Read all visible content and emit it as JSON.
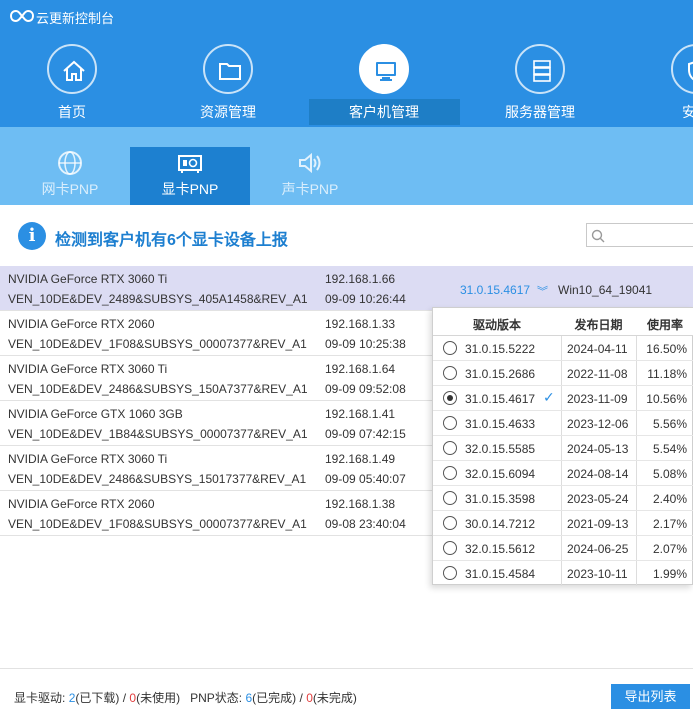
{
  "app": {
    "title": "云更新控制台",
    "logo_icon": "infinity-logo-icon"
  },
  "nav": {
    "items": [
      {
        "label": "首页",
        "icon": "home-icon"
      },
      {
        "label": "资源管理",
        "icon": "folder-icon"
      },
      {
        "label": "客户机管理",
        "icon": "monitor-icon",
        "active": true
      },
      {
        "label": "服务器管理",
        "icon": "server-icon"
      },
      {
        "label": "安全",
        "icon": "shield-icon"
      }
    ]
  },
  "subnav": {
    "items": [
      {
        "label": "网卡PNP",
        "icon": "globe-icon"
      },
      {
        "label": "显卡PNP",
        "icon": "graphics-card-icon",
        "active": true
      },
      {
        "label": "声卡PNP",
        "icon": "speaker-icon"
      }
    ]
  },
  "header": {
    "info_text": "检测到客户机有6个显卡设备上报",
    "info_icon": "info-icon",
    "search_icon": "search-icon"
  },
  "devices": [
    {
      "name": "NVIDIA GeForce RTX 3060 Ti",
      "id": "VEN_10DE&DEV_2489&SUBSYS_405A1458&REV_A1",
      "ip": "192.168.1.66",
      "time": "09-09 10:26:44",
      "version": "31.0.15.4617",
      "os": "Win10_64_19041"
    },
    {
      "name": "NVIDIA GeForce RTX 2060",
      "id": "VEN_10DE&DEV_1F08&SUBSYS_00007377&REV_A1",
      "ip": "192.168.1.33",
      "time": "09-09 10:25:38"
    },
    {
      "name": "NVIDIA GeForce RTX 3060 Ti",
      "id": "VEN_10DE&DEV_2486&SUBSYS_150A7377&REV_A1",
      "ip": "192.168.1.64",
      "time": "09-09 09:52:08"
    },
    {
      "name": "NVIDIA GeForce GTX 1060 3GB",
      "id": "VEN_10DE&DEV_1B84&SUBSYS_00007377&REV_A1",
      "ip": "192.168.1.41",
      "time": "09-09 07:42:15"
    },
    {
      "name": "NVIDIA GeForce RTX 3060 Ti",
      "id": "VEN_10DE&DEV_2486&SUBSYS_15017377&REV_A1",
      "ip": "192.168.1.49",
      "time": "09-09 05:40:07"
    },
    {
      "name": "NVIDIA GeForce RTX 2060",
      "id": "VEN_10DE&DEV_1F08&SUBSYS_00007377&REV_A1",
      "ip": "192.168.1.38",
      "time": "09-08 23:40:04"
    }
  ],
  "dropdown": {
    "headers": [
      "驱动版本",
      "发布日期",
      "使用率"
    ],
    "rows": [
      {
        "version": "31.0.15.5222",
        "date": "2024-04-11",
        "rate": "16.50%"
      },
      {
        "version": "31.0.15.2686",
        "date": "2022-11-08",
        "rate": "11.18%"
      },
      {
        "version": "31.0.15.4617",
        "date": "2023-11-09",
        "rate": "10.56%",
        "selected": true
      },
      {
        "version": "31.0.15.4633",
        "date": "2023-12-06",
        "rate": "5.56%"
      },
      {
        "version": "32.0.15.5585",
        "date": "2024-05-13",
        "rate": "5.54%"
      },
      {
        "version": "32.0.15.6094",
        "date": "2024-08-14",
        "rate": "5.08%"
      },
      {
        "version": "31.0.15.3598",
        "date": "2023-05-24",
        "rate": "2.40%"
      },
      {
        "version": "30.0.14.7212",
        "date": "2021-09-13",
        "rate": "2.17%"
      },
      {
        "version": "32.0.15.5612",
        "date": "2024-06-25",
        "rate": "2.07%"
      },
      {
        "version": "31.0.15.4584",
        "date": "2023-10-11",
        "rate": "1.99%"
      }
    ]
  },
  "footer": {
    "driver_label": "显卡驱动:",
    "downloaded_count": "2",
    "downloaded_label": "(已下载)",
    "sep": "/",
    "unused_count": "0",
    "unused_label": "(未使用)",
    "pnp_label": "PNP状态:",
    "done_count": "6",
    "done_label": "(已完成)",
    "undone_count": "0",
    "undone_label": "(未完成)",
    "export_label": "导出列表"
  },
  "colors": {
    "primary": "#2b8fe3",
    "subnav": "#6ebdf3",
    "selected_row": "#dcdcf3",
    "danger": "#e23d3d"
  }
}
